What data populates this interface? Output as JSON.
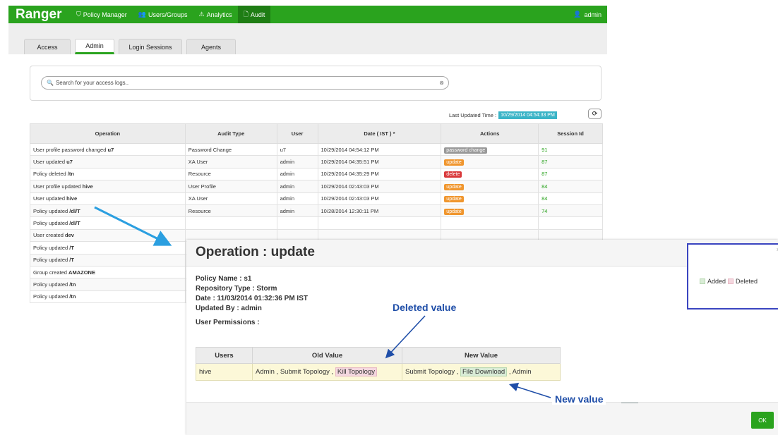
{
  "header": {
    "brand": "Ranger",
    "nav": [
      "Policy Manager",
      "Users/Groups",
      "Analytics",
      "Audit"
    ],
    "user": "admin"
  },
  "tabs": [
    "Access",
    "Admin",
    "Login Sessions",
    "Agents"
  ],
  "search": {
    "placeholder": "Search for your access logs..",
    "clear": "⊗"
  },
  "last_updated": {
    "label": "Last Updated Time :",
    "value": "10/29/2014 04:54:33 PM"
  },
  "table": {
    "headers": [
      "Operation",
      "Audit Type",
      "User",
      "Date ( IST ) *",
      "Actions",
      "Session Id"
    ],
    "rows": [
      {
        "op": "User profile password changed ",
        "target": "u7",
        "type": "Password Change",
        "user": "u7",
        "date": "10/29/2014 04:54:12 PM",
        "action": "password change",
        "action_color": "#999999",
        "session": "91"
      },
      {
        "op": "User updated ",
        "target": "u7",
        "type": "XA User",
        "user": "admin",
        "date": "10/29/2014 04:35:51 PM",
        "action": "update",
        "action_color": "#f0962e",
        "session": "87"
      },
      {
        "op": "Policy deleted ",
        "target": "/tn",
        "type": "Resource",
        "user": "admin",
        "date": "10/29/2014 04:35:29 PM",
        "action": "delete",
        "action_color": "#d9393b",
        "session": "87"
      },
      {
        "op": "User profile updated ",
        "target": "hive",
        "type": "User Profile",
        "user": "admin",
        "date": "10/29/2014 02:43:03 PM",
        "action": "update",
        "action_color": "#f0962e",
        "session": "84"
      },
      {
        "op": "User updated ",
        "target": "hive",
        "type": "XA User",
        "user": "admin",
        "date": "10/29/2014 02:43:03 PM",
        "action": "update",
        "action_color": "#f0962e",
        "session": "84"
      },
      {
        "op": "Policy updated ",
        "target": "/dl/T",
        "type": "Resource",
        "user": "admin",
        "date": "10/28/2014 12:30:11 PM",
        "action": "update",
        "action_color": "#f0962e",
        "session": "74"
      },
      {
        "op": "Policy updated ",
        "target": "/dl/T",
        "type": "",
        "user": "",
        "date": "",
        "action": "",
        "action_color": "",
        "session": ""
      },
      {
        "op": "User created ",
        "target": "dev",
        "type": "",
        "user": "",
        "date": "",
        "action": "",
        "action_color": "",
        "session": ""
      },
      {
        "op": "Policy updated ",
        "target": "/T",
        "type": "",
        "user": "",
        "date": "",
        "action": "",
        "action_color": "",
        "session": ""
      },
      {
        "op": "Policy updated ",
        "target": "/T",
        "type": "",
        "user": "",
        "date": "",
        "action": "",
        "action_color": "",
        "session": ""
      },
      {
        "op": "Group created ",
        "target": "AMAZONE",
        "type": "",
        "user": "",
        "date": "",
        "action": "",
        "action_color": "",
        "session": ""
      },
      {
        "op": "Policy updated ",
        "target": "/tn",
        "type": "",
        "user": "",
        "date": "",
        "action": "",
        "action_color": "",
        "session": ""
      },
      {
        "op": "Policy updated ",
        "target": "/tn",
        "type": "",
        "user": "",
        "date": "",
        "action": "",
        "action_color": "",
        "session": ""
      }
    ]
  },
  "modal": {
    "title": "Operation : update",
    "policy_name": "Policy Name : s1",
    "repo_type": "Repository Type : Storm",
    "date": "Date   : 11/03/2014 01:32:36 PM IST",
    "updated_by": "Updated By   : admin",
    "perm_title": "User Permissions :",
    "perm_headers": [
      "Users",
      "Old Value",
      "New Value"
    ],
    "perm_row": {
      "user": "hive",
      "old_plain": "Admin , Submit Topology , ",
      "old_deleted": "Kill Topology",
      "new_plain1": "Submit Topology , ",
      "new_added": "File Download",
      "new_plain2": " , Admin"
    },
    "ok": "OK",
    "close": "×"
  },
  "annotations": {
    "deleted": "Deleted value",
    "new": "New value"
  },
  "legend": {
    "added": "Added",
    "deleted": "Deleted",
    "added_color": "#d9ecd6",
    "deleted_color": "#f4d7df"
  },
  "colors": {
    "brand_green": "#2aa31e",
    "annotation_blue": "#1f4ea8",
    "arrow_blue": "#2b9fe0"
  }
}
